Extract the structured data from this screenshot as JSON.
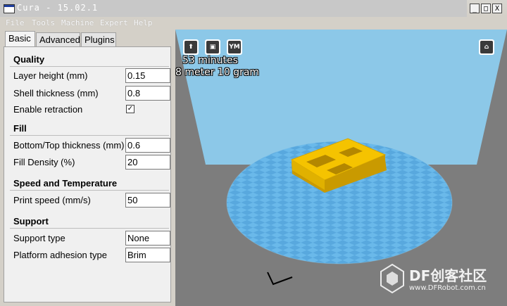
{
  "window": {
    "title": "Cura - 15.02.1",
    "min": "_",
    "max": "□",
    "close": "X"
  },
  "menu": [
    "File",
    "Tools",
    "Machine",
    "Expert",
    "Help"
  ],
  "tabs": [
    "Basic",
    "Advanced",
    "Plugins"
  ],
  "sections": {
    "quality": "Quality",
    "fill": "Fill",
    "speed": "Speed and Temperature",
    "support": "Support"
  },
  "settings": {
    "layer_height": {
      "label": "Layer height (mm)",
      "value": "0.15"
    },
    "shell_thickness": {
      "label": "Shell thickness (mm)",
      "value": "0.8"
    },
    "enable_retraction": {
      "label": "Enable retraction",
      "checked": "✓"
    },
    "bottom_top": {
      "label": "Bottom/Top thickness (mm)",
      "value": "0.6"
    },
    "fill_density": {
      "label": "Fill Density (%)",
      "value": "20"
    },
    "print_speed": {
      "label": "Print speed (mm/s)",
      "value": "50"
    },
    "support_type": {
      "label": "Support type",
      "value": "None"
    },
    "platform_adhesion": {
      "label": "Platform adhesion type",
      "value": "Brim"
    }
  },
  "viewport": {
    "print_time": "53 minutes",
    "material": "8 meter 10 gram",
    "toolbar_icons": [
      "load-icon",
      "save-icon",
      "youmagine-icon"
    ],
    "view_mode_icon": "view-mode-icon",
    "ym_label": "YM",
    "colors": {
      "background": "#7d7d7d",
      "build_volume": "#8cc8e8",
      "platform": "#62b4e6",
      "model": "#f5c300"
    }
  },
  "watermark": {
    "brand": "DF创客社区",
    "url": "www.DFRobot.com.cn"
  }
}
